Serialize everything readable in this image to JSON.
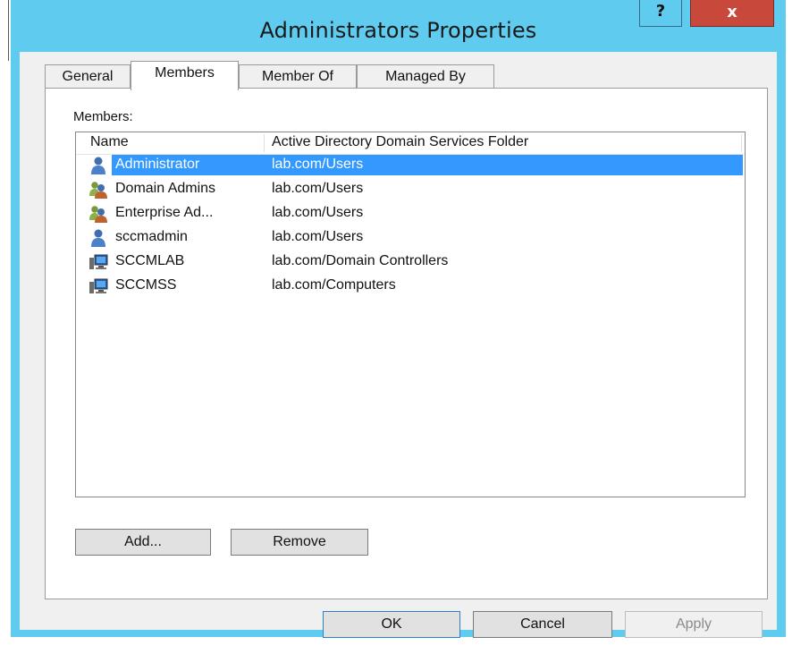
{
  "window": {
    "title": "Administrators Properties",
    "help_label": "?",
    "close_label": "x",
    "accent_color": "#5fcbee"
  },
  "tabs": [
    {
      "label": "General",
      "active": false
    },
    {
      "label": "Members",
      "active": true
    },
    {
      "label": "Member Of",
      "active": false
    },
    {
      "label": "Managed By",
      "active": false
    }
  ],
  "members": {
    "label": "Members:",
    "columns": [
      "Name",
      "Active Directory Domain Services Folder"
    ],
    "rows": [
      {
        "icon": "user-icon",
        "name": "Administrator",
        "folder": "lab.com/Users",
        "selected": true
      },
      {
        "icon": "group-icon",
        "name": "Domain Admins",
        "folder": "lab.com/Users",
        "selected": false
      },
      {
        "icon": "group-icon",
        "name": "Enterprise Ad...",
        "folder": "lab.com/Users",
        "selected": false
      },
      {
        "icon": "user-icon",
        "name": "sccmadmin",
        "folder": "lab.com/Users",
        "selected": false
      },
      {
        "icon": "computer-icon",
        "name": "SCCMLAB",
        "folder": "lab.com/Domain Controllers",
        "selected": false
      },
      {
        "icon": "computer-icon",
        "name": "SCCMSS",
        "folder": "lab.com/Computers",
        "selected": false
      }
    ],
    "add_label": "Add...",
    "remove_label": "Remove"
  },
  "footer": {
    "ok_label": "OK",
    "cancel_label": "Cancel",
    "apply_label": "Apply"
  }
}
